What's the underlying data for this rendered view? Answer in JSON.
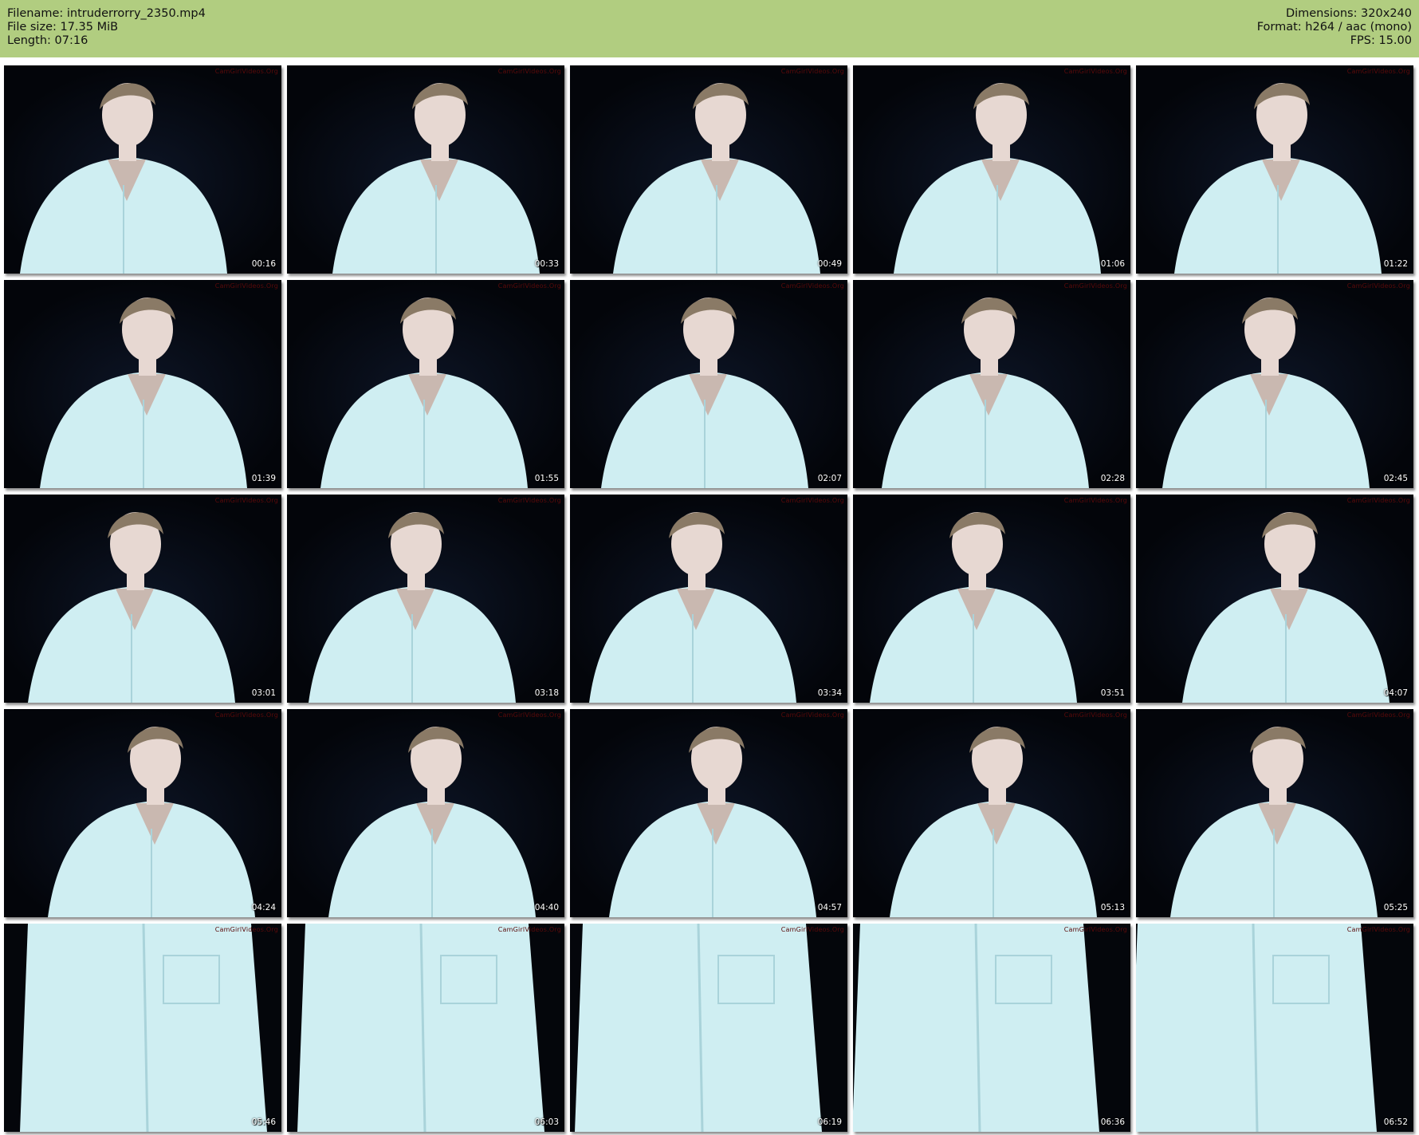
{
  "header": {
    "filename": "Filename: intruderrorry_2350.mp4",
    "filesize": "File size: 17.35 MiB",
    "length": "Length: 07:16",
    "dimensions": "Dimensions: 320x240",
    "format": "Format: h264 / aac (mono)",
    "fps": "FPS: 15.00"
  },
  "watermark": "CamGirlVideos.Org",
  "colors": {
    "header_bg": "#b1cd80",
    "frame_bg": "#05070d",
    "shirt": "#cfeef2",
    "skin": "#e7d8d2",
    "hair": "#8a7a66"
  },
  "thumbnails": [
    {
      "time": "00:16",
      "kind": "portrait"
    },
    {
      "time": "00:33",
      "kind": "portrait"
    },
    {
      "time": "00:49",
      "kind": "portrait"
    },
    {
      "time": "01:06",
      "kind": "portrait"
    },
    {
      "time": "01:22",
      "kind": "portrait"
    },
    {
      "time": "01:39",
      "kind": "portrait"
    },
    {
      "time": "01:55",
      "kind": "portrait"
    },
    {
      "time": "02:07",
      "kind": "portrait"
    },
    {
      "time": "02:28",
      "kind": "portrait"
    },
    {
      "time": "02:45",
      "kind": "portrait"
    },
    {
      "time": "03:01",
      "kind": "portrait"
    },
    {
      "time": "03:18",
      "kind": "portrait"
    },
    {
      "time": "03:34",
      "kind": "portrait"
    },
    {
      "time": "03:51",
      "kind": "portrait"
    },
    {
      "time": "04:07",
      "kind": "portrait"
    },
    {
      "time": "04:24",
      "kind": "portrait"
    },
    {
      "time": "04:40",
      "kind": "portrait"
    },
    {
      "time": "04:57",
      "kind": "portrait"
    },
    {
      "time": "05:13",
      "kind": "portrait"
    },
    {
      "time": "05:25",
      "kind": "portrait"
    },
    {
      "time": "05:46",
      "kind": "closeup"
    },
    {
      "time": "06:03",
      "kind": "closeup"
    },
    {
      "time": "06:19",
      "kind": "closeup"
    },
    {
      "time": "06:36",
      "kind": "closeup"
    },
    {
      "time": "06:52",
      "kind": "closeup"
    }
  ]
}
